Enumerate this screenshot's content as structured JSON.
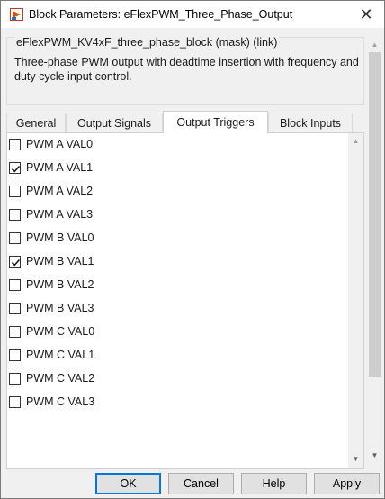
{
  "window": {
    "title": "Block Parameters: eFlexPWM_Three_Phase_Output",
    "close_symbol": "✕"
  },
  "description": {
    "group_title": "eFlexPWM_KV4xF_three_phase_block (mask) (link)",
    "text": "Three-phase PWM output with deadtime insertion with frequency and duty cycle input control."
  },
  "tabs": [
    {
      "label": "General",
      "active": false
    },
    {
      "label": "Output Signals",
      "active": false
    },
    {
      "label": "Output Triggers",
      "active": true
    },
    {
      "label": "Block Inputs",
      "active": false
    }
  ],
  "triggers": [
    {
      "label": "PWM A VAL0",
      "checked": false
    },
    {
      "label": "PWM A VAL1",
      "checked": true
    },
    {
      "label": "PWM A VAL2",
      "checked": false
    },
    {
      "label": "PWM A VAL3",
      "checked": false
    },
    {
      "label": "PWM B VAL0",
      "checked": false
    },
    {
      "label": "PWM B VAL1",
      "checked": true
    },
    {
      "label": "PWM B VAL2",
      "checked": false
    },
    {
      "label": "PWM B VAL3",
      "checked": false
    },
    {
      "label": "PWM C VAL0",
      "checked": false
    },
    {
      "label": "PWM C VAL1",
      "checked": false
    },
    {
      "label": "PWM C VAL2",
      "checked": false
    },
    {
      "label": "PWM C VAL3",
      "checked": false
    }
  ],
  "buttons": {
    "ok": "OK",
    "cancel": "Cancel",
    "help": "Help",
    "apply": "Apply"
  },
  "icons": {
    "app": "simulink-block-icon",
    "close": "close-icon",
    "scroll_up": "chevron-up-icon",
    "scroll_down": "chevron-down-icon",
    "check": "checkmark-icon"
  },
  "colors": {
    "accent": "#0078d7",
    "panel": "#ffffff",
    "background": "#f0f0f0"
  }
}
